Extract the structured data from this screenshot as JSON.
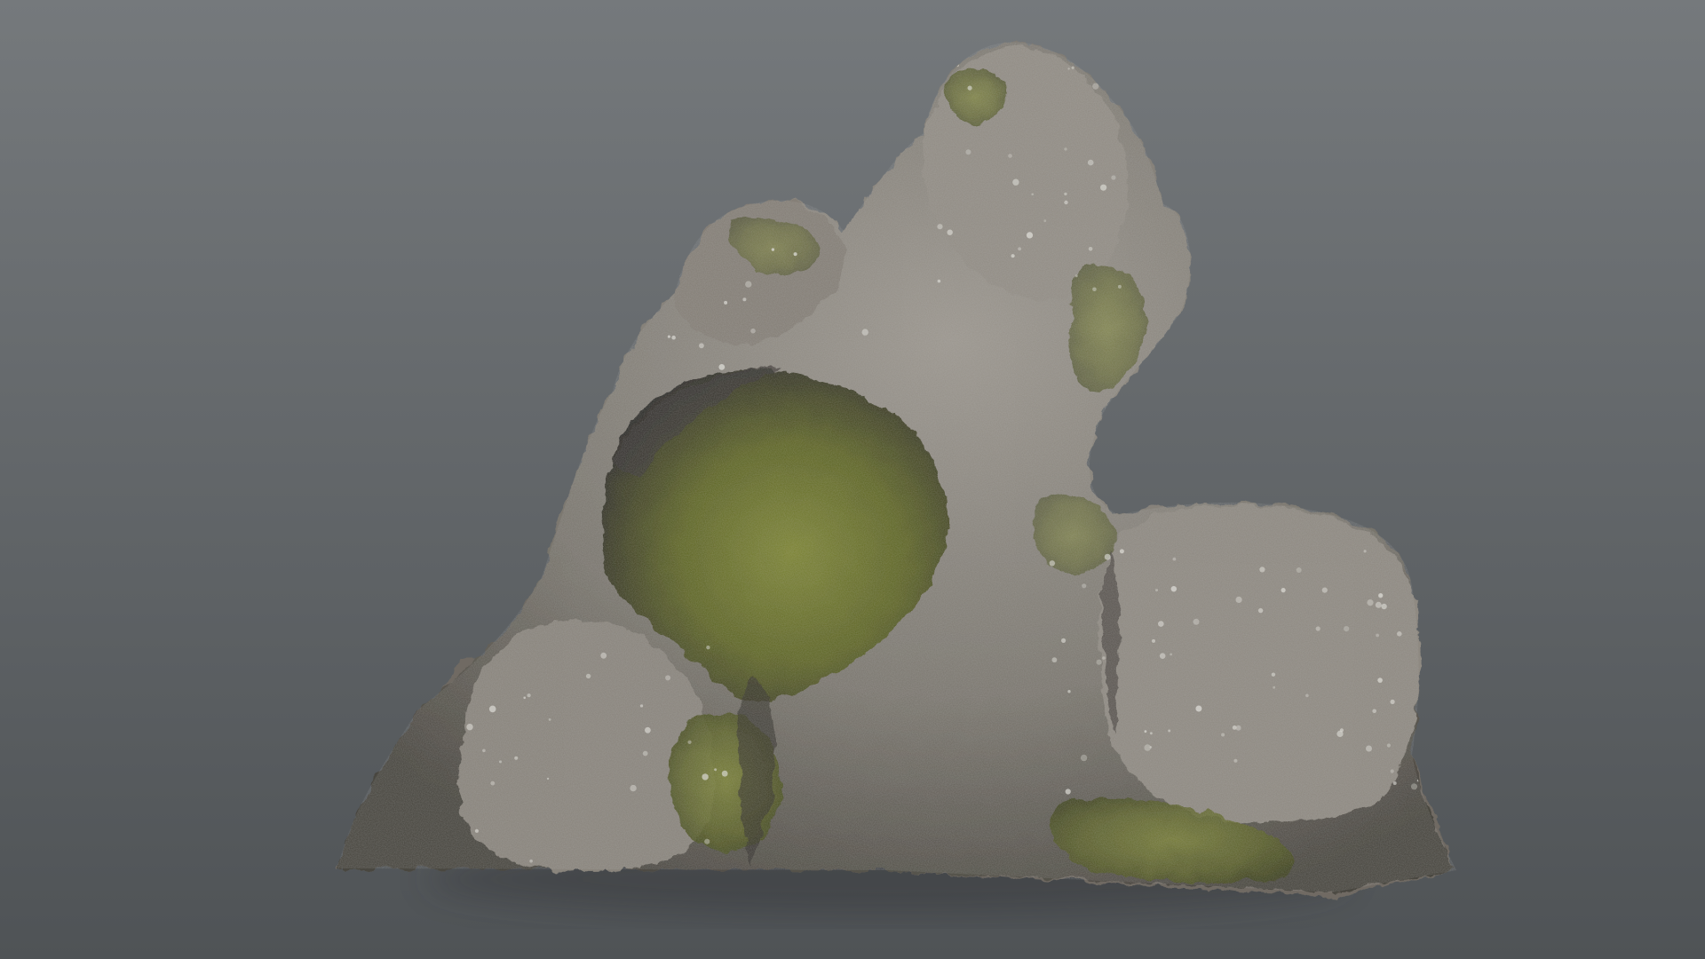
{
  "viewer": {
    "background": {
      "top_color": "#75797c",
      "bottom_color": "#4f5356"
    },
    "model": {
      "subject": "mossy-rock-formation",
      "colors": {
        "stone_light": "#9c978f",
        "stone_mid": "#7b776f",
        "stone_dark": "#4a4740",
        "stone_shadow": "#2f2d29",
        "moss_light": "#7d8534",
        "moss_mid": "#5e6526",
        "moss_dark": "#3c4218",
        "speck": "#d9d8d2"
      }
    }
  }
}
